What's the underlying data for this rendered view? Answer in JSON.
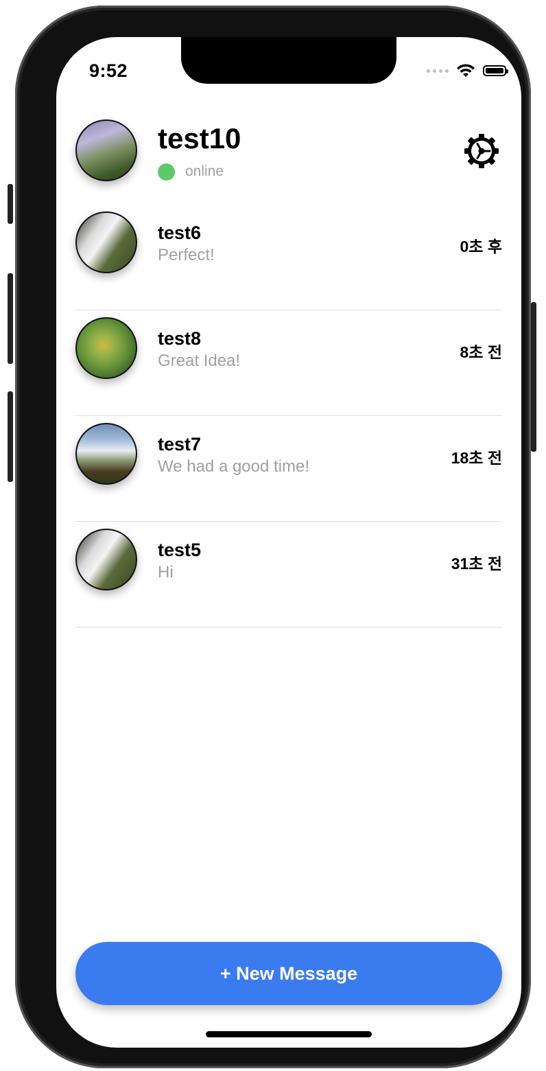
{
  "status_bar": {
    "time": "9:52"
  },
  "profile": {
    "name": "test10",
    "status": "online",
    "status_color": "#5cc96a"
  },
  "conversations": [
    {
      "name": "test6",
      "preview": "Perfect!",
      "time": "0초 후",
      "avatar": "waterfall-photo"
    },
    {
      "name": "test8",
      "preview": "Great Idea!",
      "time": "8초 전",
      "avatar": "leaf-photo"
    },
    {
      "name": "test7",
      "preview": "We had a good time!",
      "time": "18초 전",
      "avatar": "waterfall-photo"
    },
    {
      "name": "test5",
      "preview": "Hi",
      "time": "31초 전",
      "avatar": "waterfall-photo"
    }
  ],
  "new_message_button": {
    "label": "+ New Message",
    "color": "#3a7bef"
  },
  "icons": {
    "settings": "gear-icon",
    "wifi": "wifi-icon",
    "battery": "battery-icon"
  }
}
